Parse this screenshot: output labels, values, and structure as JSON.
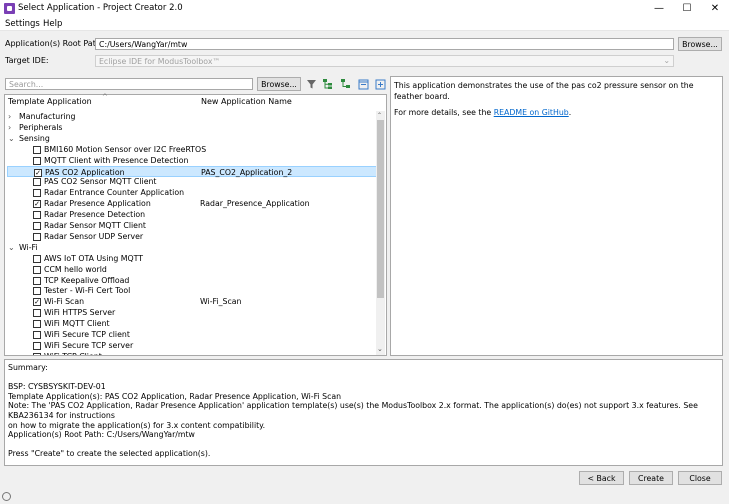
{
  "window": {
    "title": "Select Application - Project Creator 2.0",
    "minimize_glyph": "—",
    "maximize_glyph": "☐",
    "close_glyph": "✕"
  },
  "menu": {
    "items": [
      "Settings",
      "Help"
    ]
  },
  "root_path": {
    "label": "Application(s) Root Path:",
    "value": "C:/Users/WangYar/mtw",
    "browse_label": "Browse..."
  },
  "target_ide": {
    "label": "Target IDE:",
    "value": "Eclipse IDE for ModusToolbox™"
  },
  "search": {
    "placeholder": "Search...",
    "browse_label": "Browse..."
  },
  "toolbar_icons": [
    "filter-icon",
    "expand-checked-icon",
    "collapse-all-icon",
    "collapse-icon",
    "expand-all-icon"
  ],
  "tree": {
    "header_template": "Template Application",
    "header_new_name": "New Application Name",
    "rows": [
      {
        "type": "group",
        "expanded": false,
        "label": "Manufacturing"
      },
      {
        "type": "group",
        "expanded": false,
        "label": "Peripherals"
      },
      {
        "type": "group",
        "expanded": true,
        "label": "Sensing"
      },
      {
        "type": "item",
        "checked": false,
        "label": "BMI160 Motion Sensor over I2C FreeRTOS",
        "new_name": ""
      },
      {
        "type": "item",
        "checked": false,
        "label": "MQTT Client with Presence Detection",
        "new_name": ""
      },
      {
        "type": "item",
        "checked": true,
        "selected": true,
        "label": "PAS CO2 Application",
        "new_name": "PAS_CO2_Application_2"
      },
      {
        "type": "item",
        "checked": false,
        "label": "PAS CO2 Sensor MQTT Client",
        "new_name": ""
      },
      {
        "type": "item",
        "checked": false,
        "label": "Radar Entrance Counter Application",
        "new_name": ""
      },
      {
        "type": "item",
        "checked": true,
        "label": "Radar Presence Application",
        "new_name": "Radar_Presence_Application"
      },
      {
        "type": "item",
        "checked": false,
        "label": "Radar Presence Detection",
        "new_name": ""
      },
      {
        "type": "item",
        "checked": false,
        "label": "Radar Sensor MQTT Client",
        "new_name": ""
      },
      {
        "type": "item",
        "checked": false,
        "label": "Radar Sensor UDP Server",
        "new_name": ""
      },
      {
        "type": "group",
        "expanded": true,
        "label": "Wi-Fi"
      },
      {
        "type": "item",
        "checked": false,
        "label": "AWS IoT OTA Using MQTT",
        "new_name": ""
      },
      {
        "type": "item",
        "checked": false,
        "label": "CCM hello world",
        "new_name": ""
      },
      {
        "type": "item",
        "checked": false,
        "label": "TCP Keepalive Offload",
        "new_name": ""
      },
      {
        "type": "item",
        "checked": false,
        "label": "Tester - Wi-Fi Cert Tool",
        "new_name": ""
      },
      {
        "type": "item",
        "checked": true,
        "label": "Wi-Fi Scan",
        "new_name": "Wi-Fi_Scan"
      },
      {
        "type": "item",
        "checked": false,
        "label": "WiFi HTTPS Server",
        "new_name": ""
      },
      {
        "type": "item",
        "checked": false,
        "label": "WiFi MQTT Client",
        "new_name": ""
      },
      {
        "type": "item",
        "checked": false,
        "label": "WiFi Secure TCP client",
        "new_name": ""
      },
      {
        "type": "item",
        "checked": false,
        "label": "WiFi Secure TCP server",
        "new_name": ""
      },
      {
        "type": "item",
        "checked": false,
        "label": "WiFi TCP Client",
        "new_name": ""
      }
    ]
  },
  "description": {
    "text": "This application demonstrates the use of the pas co2 pressure sensor on the feather board.",
    "details_prefix": "For more details, see the ",
    "link_text": "README on GitHub",
    "details_suffix": "."
  },
  "summary": {
    "text": "Summary:\n\nBSP: CYSBSYSKIT-DEV-01\nTemplate Application(s): PAS CO2 Application, Radar Presence Application, Wi-Fi Scan\nNote: The 'PAS CO2 Application, Radar Presence Application' application template(s) use(s) the ModusToolbox 2.x format. The application(s) do(es) not support 3.x features. See KBA236134 for instructions\non how to migrate the application(s) for 3.x content compatibility.\nApplication(s) Root Path: C:/Users/WangYar/mtw\n\nPress \"Create\" to create the selected application(s)."
  },
  "buttons": {
    "back": "< Back",
    "create": "Create",
    "close": "Close"
  }
}
